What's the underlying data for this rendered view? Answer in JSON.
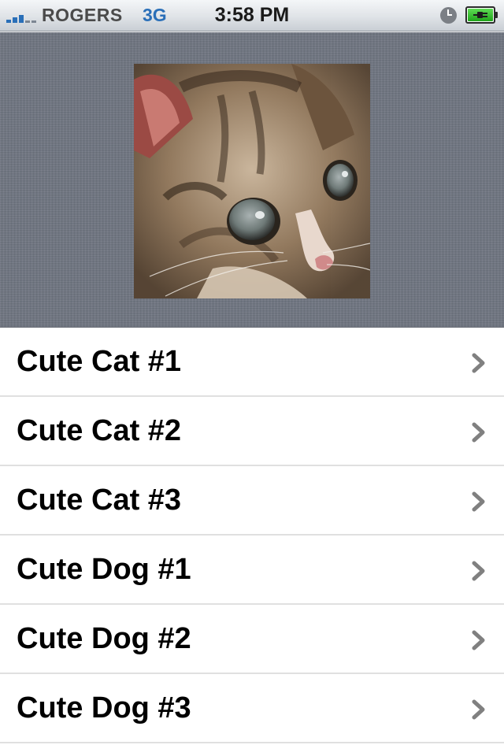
{
  "status_bar": {
    "carrier": "ROGERS",
    "network": "3G",
    "time": "3:58 PM",
    "icons": [
      "signal-bars-icon",
      "alarm-clock-icon",
      "battery-charging-icon"
    ],
    "accent": "#2a6fb8",
    "battery_color": "#2fbf27"
  },
  "header": {
    "image": "kitten-photo",
    "background": "linen-gray"
  },
  "list": {
    "items": [
      {
        "label": "Cute Cat #1"
      },
      {
        "label": "Cute Cat #2"
      },
      {
        "label": "Cute Cat #3"
      },
      {
        "label": "Cute Dog #1"
      },
      {
        "label": "Cute Dog #2"
      },
      {
        "label": "Cute Dog #3"
      }
    ],
    "accessory_icon": "chevron-right-icon",
    "accessory_color": "#808080"
  }
}
